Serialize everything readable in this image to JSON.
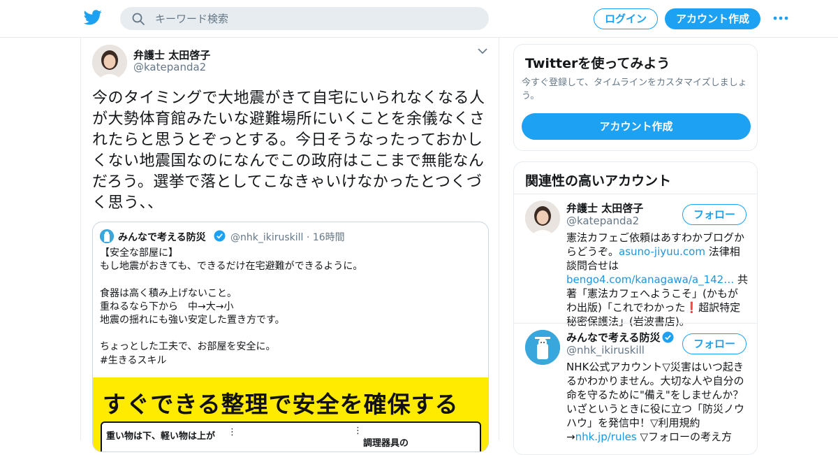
{
  "header": {
    "search_placeholder": "キーワード検索",
    "login_label": "ログイン",
    "signup_label": "アカウント作成",
    "brand_color": "#1da1f2"
  },
  "tweet": {
    "author_name": "弁護士 太田啓子",
    "author_handle": "@katepanda2",
    "text": "今のタイミングで大地震がきて自宅にいられなくなる人が大勢体育館みたいな避難場所にいくことを余儀なくされたらと思うとぞっとする。今日そうなったっておかしくない地震国なのになんでこの政府はここまで無能なんだろう。選挙で落としてこなきゃいけなかったとつくづく思う、、",
    "quote": {
      "author_name": "みんなで考える防災",
      "author_handle": "@nhk_ikiruskill",
      "time": "16時間",
      "text": "【安全な部屋に】\nもし地震がおきても、できるだけ在宅避難ができるように。\n\n食器は高く積み上げないこと。\n重ねるなら下から　中→大→小\n地震の揺れにも強い安定した置き方です。\n\nちょっとした工夫で、お部屋を安全に。\n#生きるスキル",
      "image_headline": "すぐできる整理で安全を確保する",
      "image_panel_left": "重い物は下、軽い物は上が",
      "image_panel_right": "調理器具の"
    }
  },
  "sidebar": {
    "try_card": {
      "title": "Twitterを使ってみよう",
      "desc": "今すぐ登録して、タイムラインをカスタマイズしましょう。",
      "button_label": "アカウント作成"
    },
    "related": {
      "title": "関連性の高いアカウント",
      "follow_label": "フォロー",
      "accounts": [
        {
          "name": "弁護士 太田啓子",
          "handle": "@katepanda2",
          "bio_1": "憲法カフェご依頼はあすわかブログからどうぞ。",
          "bio_link1": "asuno-jiyuu.com",
          "bio_2": " 法律相談問合せは",
          "bio_link2": "bengo4.com/kanagawa/a_142…",
          "bio_3": " 共著「憲法カフェへようこそ」(かもがわ出版)「これでわかった",
          "bio_mark": "❗",
          "bio_4": "超訳特定秘密保護法」(岩波書店)。"
        },
        {
          "name": "みんなで考える防災",
          "handle": "@nhk_ikiruskill",
          "bio_1": "NHK公式アカウント▽災害はいつ起きるかわかりません。大切な人や自分の命を守るために\"備え\"をしませんか？いざというときに役に立つ「防災ノウハウ」を発信中！▽利用規約→",
          "bio_link1": "nhk.jp/rules",
          "bio_2": " ▽フォローの考え方"
        }
      ]
    }
  }
}
